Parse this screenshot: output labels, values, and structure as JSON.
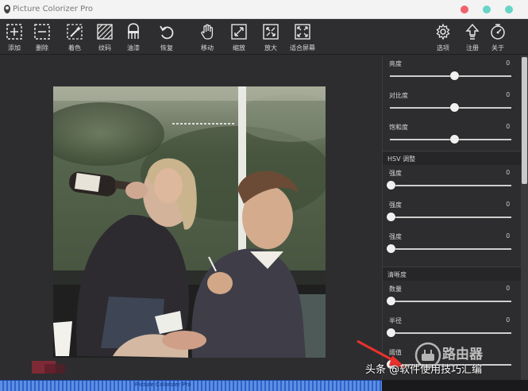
{
  "window": {
    "title": "Picture Colorizer Pro",
    "dots": [
      "#f0626b",
      "#66d4c6",
      "#66d4c6"
    ]
  },
  "toolbar": {
    "left_tools": [
      {
        "label": "添加",
        "icon": "add-box-icon"
      },
      {
        "label": "删除",
        "icon": "remove-box-icon"
      },
      {
        "label": "着色",
        "icon": "magic-wand-icon"
      },
      {
        "label": "纹码",
        "icon": "hatch-icon"
      },
      {
        "label": "油漆",
        "icon": "paint-bucket-icon"
      },
      {
        "label": "恢复",
        "icon": "undo-icon"
      },
      {
        "label": "移动",
        "icon": "hand-icon"
      },
      {
        "label": "缩放",
        "icon": "zoom-out-icon"
      },
      {
        "label": "放大",
        "icon": "zoom-in-icon"
      },
      {
        "label": "适合屏幕",
        "icon": "fit-screen-icon"
      }
    ],
    "right_tools": [
      {
        "label": "选项",
        "icon": "gear-icon"
      },
      {
        "label": "注册",
        "icon": "register-arrow-icon"
      },
      {
        "label": "关于",
        "icon": "about-icon"
      }
    ]
  },
  "panel": {
    "basic": [
      {
        "label": "亮度",
        "value": "0",
        "level": 0.5
      },
      {
        "label": "对比度",
        "value": "0",
        "level": 0.5
      },
      {
        "label": "饱和度",
        "value": "0",
        "level": 0.5
      }
    ],
    "hsv_title": "HSV 调整",
    "hsv": [
      {
        "label": "强度",
        "value": "0",
        "level": 0.0
      },
      {
        "label": "强度",
        "value": "0",
        "level": 0.0
      },
      {
        "label": "强度",
        "value": "0",
        "level": 0.0
      }
    ],
    "sharpness_title": "清晰度",
    "sharpness": [
      {
        "label": "数量",
        "value": "0",
        "level": 0.0
      },
      {
        "label": "半径",
        "value": "0",
        "level": 0.0
      },
      {
        "label": "阈值",
        "value": "",
        "level": 0.0
      }
    ]
  },
  "statusbar": {
    "text": "Picture Colorizer Pro"
  },
  "overlay": {
    "caption": "头条 @软件使用技巧汇编",
    "badge_text": "路由器"
  }
}
